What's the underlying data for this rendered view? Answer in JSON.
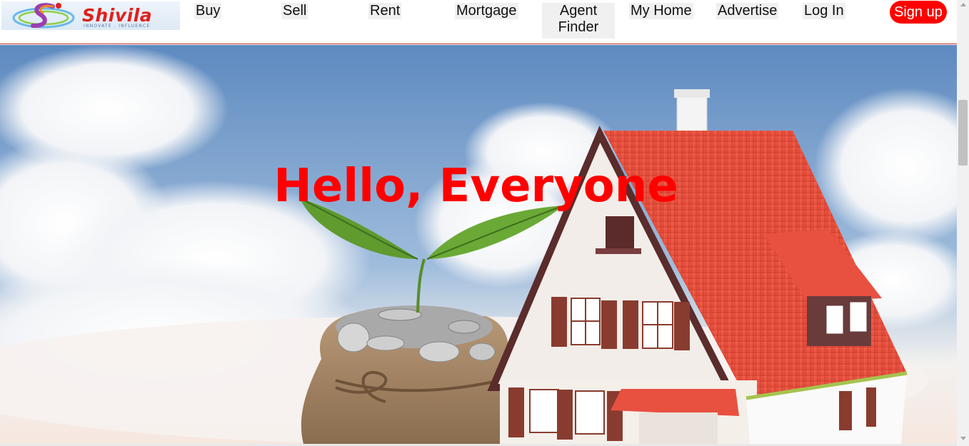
{
  "brand": {
    "name": "Shivila",
    "tagline": "INNOVATE . INFLUENCE"
  },
  "nav": {
    "buy": "Buy",
    "sell": "Sell",
    "rent": "Rent",
    "mortgage": "Mortgage",
    "agent_finder_line1": "Agent",
    "agent_finder_line2": "Finder",
    "my_home": "My Home",
    "advertise": "Advertise",
    "login": "Log In",
    "signup": "Sign up"
  },
  "hero": {
    "title": "Hello, Everyone"
  },
  "colors": {
    "accent": "#ff0000",
    "nav_item_bg": "#f0f0f0",
    "roof": "#e84a3a",
    "sky": "#6f97c4"
  },
  "icons": {
    "logo": "swoosh-s-logo-icon"
  }
}
